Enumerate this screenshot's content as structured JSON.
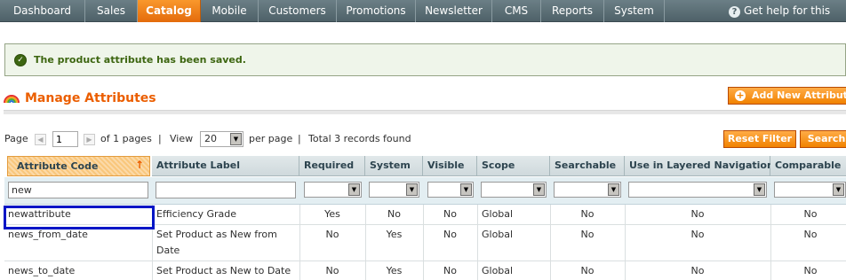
{
  "nav": {
    "items": [
      "Dashboard",
      "Sales",
      "Catalog",
      "Mobile",
      "Customers",
      "Promotions",
      "Newsletter",
      "CMS",
      "Reports",
      "System"
    ],
    "active": "Catalog",
    "help": "Get help for this page"
  },
  "message": {
    "text": "The product attribute has been saved."
  },
  "page": {
    "title": "Manage Attributes",
    "add_button": "Add New Attribute"
  },
  "pager": {
    "page_label": "Page",
    "page_value": "1",
    "of_pages": "of 1 pages",
    "divider1": "|",
    "view_label": "View",
    "per_page_value": "20",
    "per_page_label": "per page",
    "divider2": "|",
    "total": "Total 3 records found",
    "reset_button": "Reset Filter",
    "search_button": "Search"
  },
  "grid": {
    "headers": [
      "Attribute Code",
      "Attribute Label",
      "Required",
      "System",
      "Visible",
      "Scope",
      "Searchable",
      "Use in Layered Navigation",
      "Comparable"
    ],
    "sort_indicator": "↑",
    "filter_code": "new",
    "rows": [
      {
        "code": "newattribute",
        "label": "Efficiency Grade",
        "required": "Yes",
        "system": "No",
        "visible": "No",
        "scope": "Global",
        "searchable": "No",
        "layered": "No",
        "comparable": "No"
      },
      {
        "code": "news_from_date",
        "label_line1": "Set Product as New from",
        "label_line2": "Date",
        "required": "No",
        "system": "Yes",
        "visible": "No",
        "scope": "Global",
        "searchable": "No",
        "layered": "No",
        "comparable": "No"
      },
      {
        "code": "news_to_date",
        "label": "Set Product as New to Date",
        "required": "No",
        "system": "Yes",
        "visible": "No",
        "scope": "Global",
        "searchable": "No",
        "layered": "No",
        "comparable": "No"
      }
    ]
  },
  "colors": {
    "accent": "#eb5e00",
    "nav": "#5a6e75",
    "success": "#3d6611",
    "highlight": "#0015c6"
  },
  "icons": [
    "help-icon",
    "check-icon",
    "rainbow-icon",
    "plus-icon",
    "arrow-left-icon",
    "arrow-right-icon",
    "select-arrow-icon",
    "sort-asc-icon"
  ]
}
